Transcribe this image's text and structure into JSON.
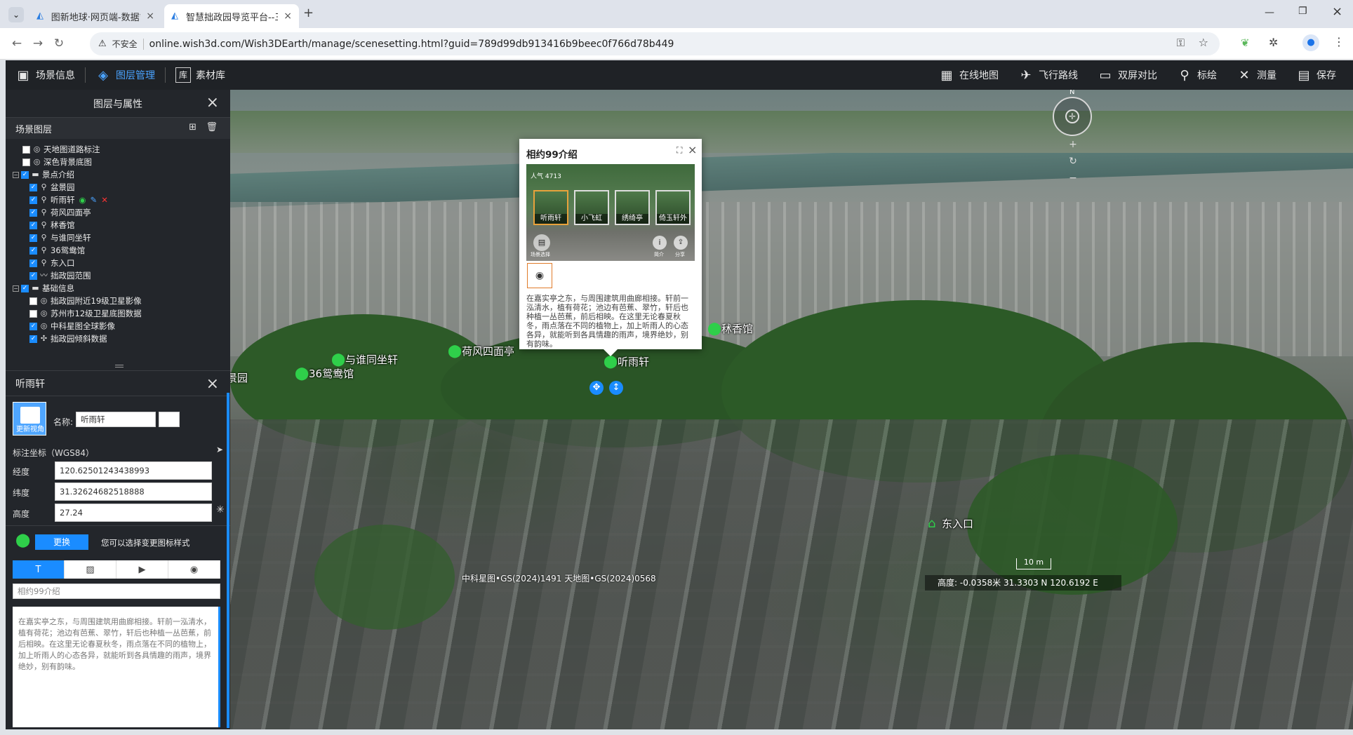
{
  "browser": {
    "tabs": [
      {
        "title": "图新地球·网页端-数据管理平台",
        "active": false
      },
      {
        "title": "智慧拙政园导览平台--三维场景",
        "active": true
      }
    ],
    "security_label": "不安全",
    "url": "online.wish3d.com/Wish3DEarth/manage/scenesetting.html?guid=789d99db913416b9beec0f766d78b449"
  },
  "appbar": {
    "left": [
      {
        "label": "场景信息",
        "icon": "scene-info-icon"
      },
      {
        "label": "图层管理",
        "icon": "layers-icon",
        "active": true
      },
      {
        "label": "素材库",
        "icon": "library-icon",
        "glyph": "库"
      }
    ],
    "right": [
      {
        "label": "在线地图",
        "icon": "map-icon"
      },
      {
        "label": "飞行路线",
        "icon": "plane-icon"
      },
      {
        "label": "双屏对比",
        "icon": "monitor-icon"
      },
      {
        "label": "标绘",
        "icon": "pin-icon"
      },
      {
        "label": "测量",
        "icon": "ruler-icon"
      },
      {
        "label": "保存",
        "icon": "save-icon"
      }
    ]
  },
  "layer_panel": {
    "title": "图层与属性",
    "section_title": "场景图层",
    "tree": [
      {
        "label": "天地图道路标注",
        "checked": false,
        "level": 1,
        "icon": "globe-icon"
      },
      {
        "label": "深色背景底图",
        "checked": false,
        "level": 1,
        "icon": "globe-icon"
      },
      {
        "label": "景点介绍",
        "checked": true,
        "level": 0,
        "group": true,
        "icon": "folder-icon"
      },
      {
        "label": "盆景园",
        "checked": true,
        "level": 2,
        "icon": "pin-icon"
      },
      {
        "label": "听雨轩",
        "checked": true,
        "level": 2,
        "icon": "pin-icon",
        "selected": true
      },
      {
        "label": "荷风四面亭",
        "checked": true,
        "level": 2,
        "icon": "pin-icon"
      },
      {
        "label": "秫香馆",
        "checked": true,
        "level": 2,
        "icon": "pin-icon"
      },
      {
        "label": "与谁同坐轩",
        "checked": true,
        "level": 2,
        "icon": "pin-icon"
      },
      {
        "label": "36鸳鸯馆",
        "checked": true,
        "level": 2,
        "icon": "pin-icon"
      },
      {
        "label": "东入口",
        "checked": true,
        "level": 2,
        "icon": "pin-icon"
      },
      {
        "label": "拙政园范围",
        "checked": true,
        "level": 2,
        "icon": "polyline-icon"
      },
      {
        "label": "基础信息",
        "checked": true,
        "level": 0,
        "group": true,
        "icon": "folder-icon"
      },
      {
        "label": "拙政园附近19级卫星影像",
        "checked": false,
        "level": 2,
        "icon": "globe-icon"
      },
      {
        "label": "苏州市12级卫星底图数据",
        "checked": false,
        "level": 2,
        "icon": "globe-icon"
      },
      {
        "label": "中科星图全球影像",
        "checked": true,
        "level": 2,
        "icon": "globe-icon"
      },
      {
        "label": "拙政园倾斜数据",
        "checked": true,
        "level": 2,
        "icon": "model-icon"
      }
    ]
  },
  "detail": {
    "title": "听雨轩",
    "update_view": "更新视角",
    "name_label": "名称:",
    "name_value": "听雨轩",
    "coord_title": "标注坐标（WGS84）",
    "lng_label": "经度",
    "lng_value": "120.62501243438993",
    "lat_label": "纬度",
    "lat_value": "31.32624682518888",
    "alt_label": "高度",
    "alt_value": "27.24",
    "change_btn": "更换",
    "change_hint": "您可以选择变更图标样式",
    "tabs": [
      "T",
      "image-icon",
      "video-icon",
      "panorama-icon"
    ],
    "intro_title": "相约99介绍",
    "intro_text": "在嘉实亭之东，与周围建筑用曲廊相接。轩前一泓清水，植有荷花；池边有芭蕉、翠竹，轩后也种植一丛芭蕉，前后相映。在这里无论春夏秋冬，雨点落在不同的植物上，加上听雨人的心态各异，就能听到各具情趣的雨声，境界绝妙，别有韵味。"
  },
  "popup": {
    "title": "相约99介绍",
    "views_label": "人气",
    "views": "4713",
    "thumbs": [
      "听雨轩",
      "小飞虹",
      "绣绮亭",
      "倚玉轩外"
    ],
    "scene_select": "场景选择",
    "info_label": "简介",
    "share_label": "分享",
    "body": "在嘉实亭之东，与周围建筑用曲廊相接。轩前一泓清水，植有荷花；池边有芭蕉、翠竹，轩后也种植一丛芭蕉，前后相映。在这里无论春夏秋冬，雨点落在不同的植物上，加上听雨人的心态各异，就能听到各具情趣的雨声，境界绝妙，别有韵味。"
  },
  "map": {
    "markers": [
      {
        "label": "盆景园",
        "kind": "bonsai"
      },
      {
        "label": "36鸳鸯馆",
        "kind": "pin"
      },
      {
        "label": "与谁同坐轩",
        "kind": "pin"
      },
      {
        "label": "荷风四面亭",
        "kind": "pin"
      },
      {
        "label": "听雨轩",
        "kind": "pin"
      },
      {
        "label": "秫香馆",
        "kind": "pin"
      },
      {
        "label": "东入口",
        "kind": "home"
      }
    ],
    "attribution": "中科星图•GS(2024)1491 天地图•GS(2024)0568",
    "scale": "10 m",
    "status": "高度: -0.0358米 31.3303 N 120.6192 E",
    "compass_n": "N"
  }
}
